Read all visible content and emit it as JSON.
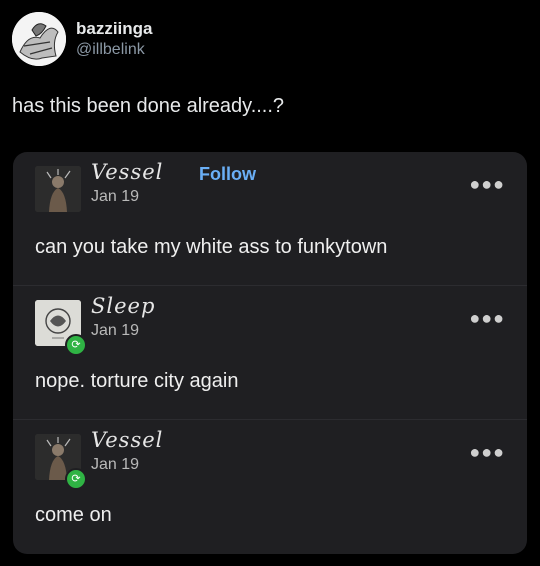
{
  "tweet": {
    "display_name": "bazziinga",
    "handle": "@illbelink",
    "text": "has this been done already....?"
  },
  "embed": {
    "posts": [
      {
        "author": "Vessel",
        "follow_label": "Follow",
        "date": "Jan 19",
        "text": "can you take my white ass to funkytown",
        "more_icon": "ellipsis-icon"
      },
      {
        "author": "Sleep",
        "date": "Jan 19",
        "text": "nope. torture city again",
        "reblog_icon": "reblog-icon",
        "more_icon": "ellipsis-icon"
      },
      {
        "author": "Vessel",
        "date": "Jan 19",
        "text": "come on",
        "reblog_icon": "reblog-icon",
        "more_icon": "ellipsis-icon"
      }
    ],
    "colors": {
      "card_bg": "#1f1f22",
      "follow": "#6aaff6",
      "reblog": "#2fb344"
    }
  }
}
